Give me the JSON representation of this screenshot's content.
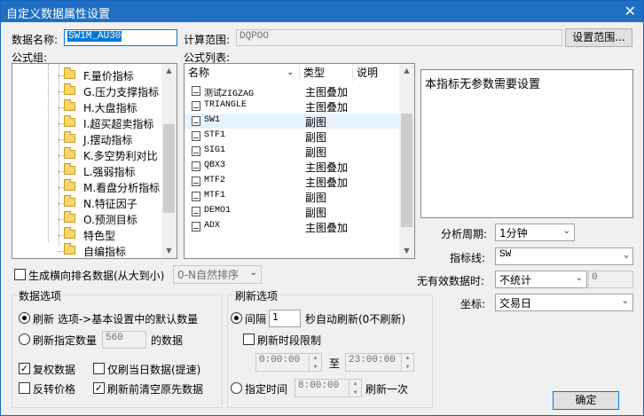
{
  "window": {
    "title": "自定义数据属性设置",
    "close": "✕"
  },
  "data_name": {
    "label": "数据名称:",
    "value": "SW1M_AU30"
  },
  "calc_range": {
    "label": "计算范围:",
    "value": "DQPOO",
    "button": "设置范围..."
  },
  "formula_group": {
    "label": "公式组:",
    "items": [
      "F.量价指标",
      "G.压力支撑指标",
      "H.大盘指标",
      "I.超买超卖指标",
      "J.摆动指标",
      "K.多空势利对比",
      "L.强弱指标",
      "M.看盘分析指标",
      "N.特征因子",
      "O.预测目标",
      "特色型",
      "自编指标"
    ]
  },
  "formula_list": {
    "label": "公式列表:",
    "headers": [
      "名称",
      "类型",
      "说明"
    ],
    "rows": [
      {
        "name": "测试ZIGZAG",
        "type": "主图叠加"
      },
      {
        "name": "TRIANGLE",
        "type": "主图叠加"
      },
      {
        "name": "SW1",
        "type": "副图"
      },
      {
        "name": "STF1",
        "type": "副图"
      },
      {
        "name": "SIG1",
        "type": "副图"
      },
      {
        "name": "QBX3",
        "type": "主图叠加"
      },
      {
        "name": "MTF2",
        "type": "主图叠加"
      },
      {
        "name": "MTF1",
        "type": "副图"
      },
      {
        "name": "DEMO1",
        "type": "副图"
      },
      {
        "name": "ADX",
        "type": "主图叠加"
      }
    ]
  },
  "param_note": "本指标无参数需要设置",
  "analysis_period": {
    "label": "分析周期:",
    "value": "1分钟"
  },
  "indicator_line": {
    "label": "指标线:",
    "value": "SW"
  },
  "invalid_data": {
    "label": "无有效数据时:",
    "value": "不统计",
    "extra": "0"
  },
  "axis": {
    "label": "坐标:",
    "value": "交易日"
  },
  "rank": {
    "label": "生成横向排名数据(从大到小)",
    "value": "0-N自然排序"
  },
  "data_options": {
    "title": "数据选项",
    "refresh_default": "刷新 选项->基本设置中的默认数量",
    "refresh_count_label": "刷新指定数量",
    "refresh_count_value": "560",
    "refresh_count_suffix": "的数据",
    "restore_rights": "复权数据",
    "today_only": "仅刷当日数据(提速)",
    "reverse_price": "反转价格",
    "clear_before": "刷新前清空原先数据"
  },
  "refresh_options": {
    "title": "刷新选项",
    "interval_label": "间隔",
    "interval_value": "1",
    "interval_suffix": "秒自动刷新(0不刷新)",
    "period_limit": "刷新时段限制",
    "time_from": "0:00:00",
    "time_to_label": "至",
    "time_to": "23:00:00",
    "fixed_time_label": "指定时间",
    "fixed_time_value": "8:00:00",
    "fixed_time_suffix": "刷新一次"
  },
  "ok_button": "确定"
}
